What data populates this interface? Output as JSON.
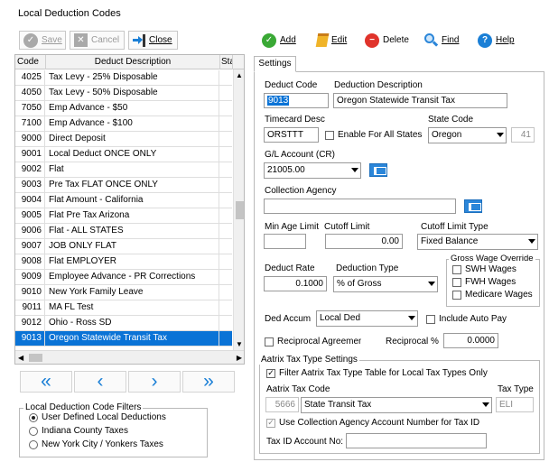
{
  "window_title": "Local Deduction Codes",
  "toolbar_left": {
    "save": "Save",
    "cancel": "Cancel",
    "close": "Close"
  },
  "toolbar_right": {
    "add": "Add",
    "edit": "Edit",
    "delete": "Delete",
    "find": "Find",
    "help": "Help"
  },
  "grid": {
    "col_code": "Code",
    "col_desc": "Deduct Description",
    "col_sta": "Sta",
    "rows": [
      {
        "code": "4025",
        "desc": "Tax Levy - 25% Disposable"
      },
      {
        "code": "4050",
        "desc": "Tax Levy - 50% Disposable"
      },
      {
        "code": "7050",
        "desc": "Emp Advance - $50"
      },
      {
        "code": "7100",
        "desc": "Emp Advance - $100"
      },
      {
        "code": "9000",
        "desc": "Direct Deposit"
      },
      {
        "code": "9001",
        "desc": "Local Deduct ONCE ONLY"
      },
      {
        "code": "9002",
        "desc": "Flat"
      },
      {
        "code": "9003",
        "desc": "Pre Tax FLAT ONCE ONLY"
      },
      {
        "code": "9004",
        "desc": "Flat Amount - California"
      },
      {
        "code": "9005",
        "desc": "Flat Pre Tax Arizona"
      },
      {
        "code": "9006",
        "desc": "Flat - ALL STATES"
      },
      {
        "code": "9007",
        "desc": "JOB ONLY FLAT"
      },
      {
        "code": "9008",
        "desc": "Flat EMPLOYER"
      },
      {
        "code": "9009",
        "desc": "Employee Advance - PR Corrections"
      },
      {
        "code": "9010",
        "desc": "New York Family Leave"
      },
      {
        "code": "9011",
        "desc": "MA FL Test"
      },
      {
        "code": "9012",
        "desc": "Ohio - Ross SD"
      },
      {
        "code": "9013",
        "desc": "Oregon Statewide Transit Tax"
      }
    ]
  },
  "nav": {
    "first": "«",
    "prev": "‹",
    "next": "›",
    "last": "»"
  },
  "filters": {
    "legend": "Local Deduction Code Filters",
    "options": [
      "User Defined Local Deductions",
      "Indiana County Taxes",
      "New York City / Yonkers Taxes"
    ],
    "selected": 0
  },
  "tab_label": "Settings",
  "form": {
    "deduct_code_label": "Deduct Code",
    "deduct_code": "9013",
    "deduction_description_label": "Deduction Description",
    "deduction_description": "Oregon Statewide Transit Tax",
    "timecard_desc_label": "Timecard Desc",
    "timecard_desc": "ORSTTT",
    "enable_all_states_label": "Enable For All States",
    "state_code_label": "State Code",
    "state_code": "Oregon",
    "state_num": "41",
    "gl_account_label": "G/L Account (CR)",
    "gl_account": "21005.00",
    "collection_agency_label": "Collection Agency",
    "collection_agency": "",
    "min_age_label": "Min Age Limit",
    "min_age": "",
    "cutoff_limit_label": "Cutoff Limit",
    "cutoff_limit": "0.00",
    "cutoff_type_label": "Cutoff Limit Type",
    "cutoff_type": "Fixed Balance",
    "deduct_rate_label": "Deduct Rate",
    "deduct_rate": "0.1000",
    "deduction_type_label": "Deduction Type",
    "deduction_type": "% of Gross",
    "gross_override_label": "Gross Wage Override",
    "swh_label": "SWH Wages",
    "fwh_label": "FWH Wages",
    "medicare_label": "Medicare Wages",
    "ded_accum_label": "Ded Accum",
    "ded_accum": "Local Ded",
    "include_auto_pay_label": "Include Auto Pay",
    "reciprocal_agreement_label": "Reciprocal Agreement",
    "reciprocal_pct_label": "Reciprocal %",
    "reciprocal_pct": "0.0000",
    "aatrix_legend": "Aatrix Tax Type Settings",
    "filter_aatrix_label": "Filter Aatrix Tax Type Table for Local Tax Types Only",
    "aatrix_tax_code_label": "Aatrix Tax Code",
    "aatrix_code_num": "5666",
    "aatrix_code": "State Transit Tax",
    "tax_type_label": "Tax Type",
    "tax_type": "ELI",
    "use_collection_label": "Use Collection Agency Account Number for Tax ID",
    "tax_id_label": "Tax ID Account No:",
    "tax_id": ""
  }
}
